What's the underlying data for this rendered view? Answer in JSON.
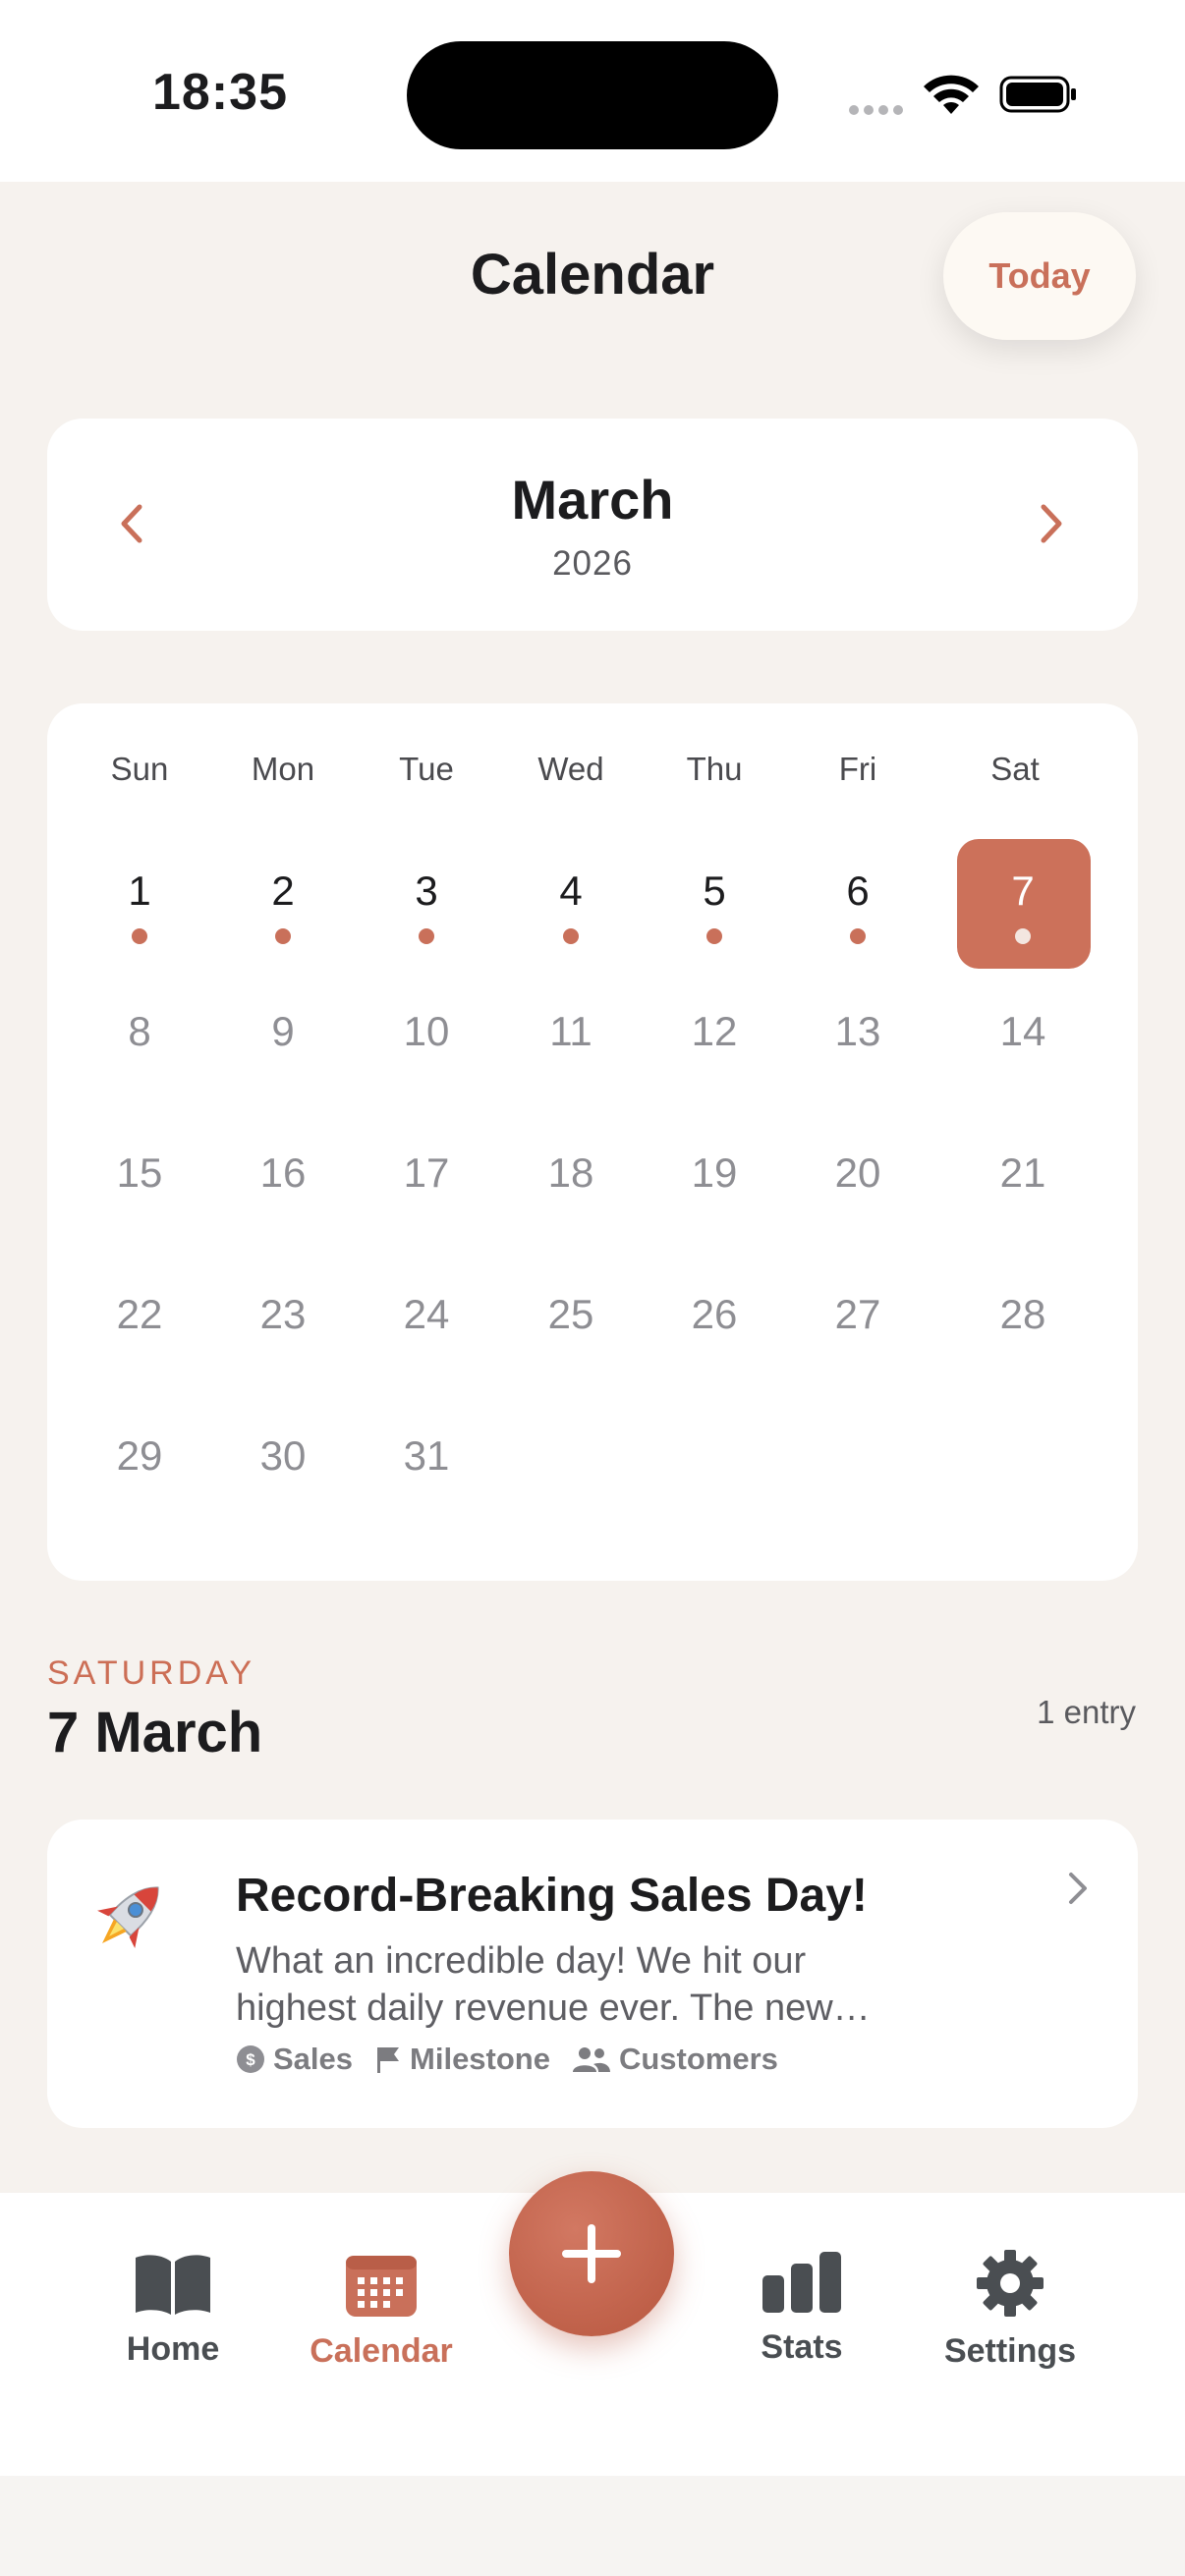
{
  "status_bar": {
    "time": "18:35"
  },
  "header": {
    "title": "Calendar",
    "today_label": "Today"
  },
  "month_picker": {
    "month": "March",
    "year": "2026"
  },
  "calendar": {
    "weekdays": [
      "Sun",
      "Mon",
      "Tue",
      "Wed",
      "Thu",
      "Fri",
      "Sat"
    ],
    "weeks": [
      [
        "1",
        "2",
        "3",
        "4",
        "5",
        "6",
        "7"
      ],
      [
        "8",
        "9",
        "10",
        "11",
        "12",
        "13",
        "14"
      ],
      [
        "15",
        "16",
        "17",
        "18",
        "19",
        "20",
        "21"
      ],
      [
        "22",
        "23",
        "24",
        "25",
        "26",
        "27",
        "28"
      ],
      [
        "29",
        "30",
        "31",
        "",
        "",
        "",
        ""
      ]
    ],
    "days_with_entries": [
      1,
      2,
      3,
      4,
      5,
      6,
      7
    ],
    "selected_day": 7
  },
  "selected_date": {
    "weekday": "SATURDAY",
    "date": "7 March",
    "entry_count": "1 entry"
  },
  "entries": [
    {
      "icon": "rocket-icon",
      "title": "Record-Breaking Sales Day!",
      "preview_line1": "What an incredible day! We hit our",
      "preview_line2": "highest daily revenue ever. The new…",
      "tags": [
        "Sales",
        "Milestone",
        "Customers"
      ]
    }
  ],
  "tab_bar": {
    "home": "Home",
    "calendar": "Calendar",
    "stats": "Stats",
    "settings": "Settings"
  },
  "colors": {
    "accent": "#C9705A",
    "background": "#F6F2EE",
    "card": "#FFFFFF",
    "text": "#1C1C1E"
  }
}
